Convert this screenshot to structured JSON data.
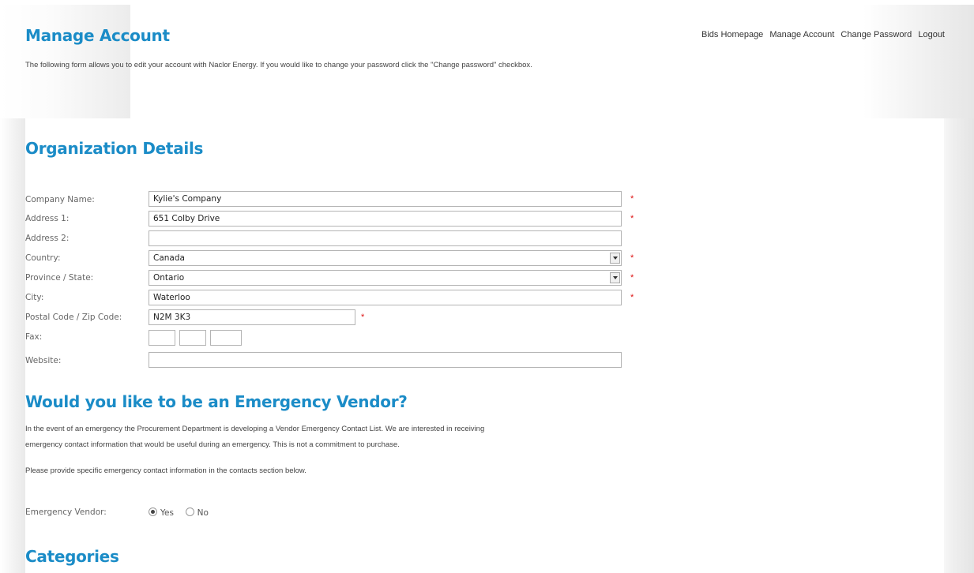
{
  "header": {
    "title": "Manage Account",
    "intro": "The following form allows you to edit your account with Naclor Energy. If you would like to change your password click the \"Change password\" checkbox."
  },
  "nav": {
    "bids_homepage": "Bids Homepage",
    "manage_account": "Manage Account",
    "change_password": "Change Password",
    "logout": "Logout"
  },
  "organization": {
    "title": "Organization Details",
    "company_name": {
      "label": "Company Name:",
      "value": "Kylie's Company"
    },
    "address1": {
      "label": "Address 1:",
      "value": "651 Colby Drive"
    },
    "address2": {
      "label": "Address 2:",
      "value": ""
    },
    "country": {
      "label": "Country:",
      "value": "Canada"
    },
    "province": {
      "label": "Province / State:",
      "value": "Ontario"
    },
    "city": {
      "label": "City:",
      "value": "Waterloo"
    },
    "postal": {
      "label": "Postal Code / Zip Code:",
      "value": "N2M 3K3"
    },
    "fax": {
      "label": "Fax:",
      "parts": [
        "",
        "",
        ""
      ]
    },
    "website": {
      "label": "Website:",
      "value": ""
    },
    "required_mark": "*"
  },
  "emergency": {
    "title": "Would you like to be an Emergency Vendor?",
    "para1_line1": "In the event of an emergency the  Procurement Department is developing a Vendor Emergency Contact List. We are interested in receiving",
    "para1_line2": "emergency contact information that would be useful during an emergency. This is not a commitment to purchase.",
    "para2": "Please provide specific emergency contact information in the contacts section below.",
    "label": "Emergency Vendor:",
    "yes": "Yes",
    "no": "No",
    "selected": "Yes"
  },
  "categories": {
    "title": "Categories"
  },
  "colors": {
    "heading": "#1b8cc7",
    "required": "#dd1111"
  }
}
